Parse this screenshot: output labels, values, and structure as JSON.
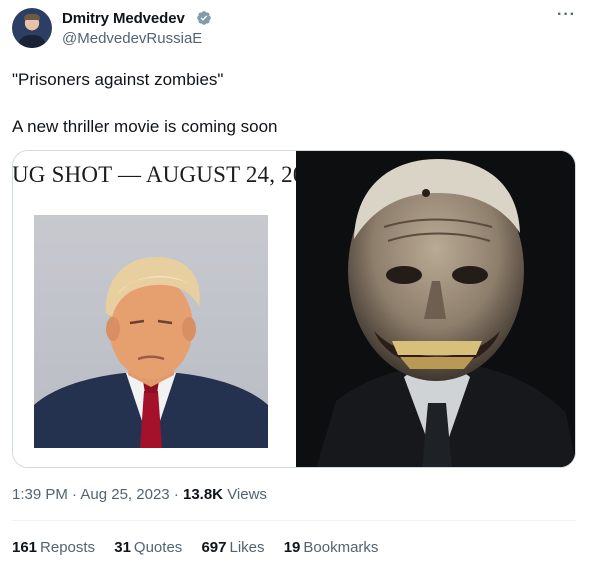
{
  "author": {
    "display_name": "Dmitry Medvedev",
    "handle": "@MedvedevRussiaE"
  },
  "tweet": {
    "line1": "\"Prisoners against zombies\"",
    "line2": "A new thriller movie is coming soon"
  },
  "media": {
    "caption_text": "UG SHOT — AUGUST 24, 20"
  },
  "meta": {
    "time": "1:39 PM",
    "separator": "·",
    "date": "Aug 25, 2023",
    "views_count": "13.8K",
    "views_label": "Views"
  },
  "stats": [
    {
      "count": "161",
      "label": "Reposts"
    },
    {
      "count": "31",
      "label": "Quotes"
    },
    {
      "count": "697",
      "label": "Likes"
    },
    {
      "count": "19",
      "label": "Bookmarks"
    }
  ],
  "colors": {
    "verified_badge": "#829aab",
    "secondary_text": "#536471",
    "primary_text": "#0f1419",
    "border": "#cfd9de"
  },
  "icons": {
    "verified": "verified-badge-icon",
    "more": "more-options-icon"
  }
}
